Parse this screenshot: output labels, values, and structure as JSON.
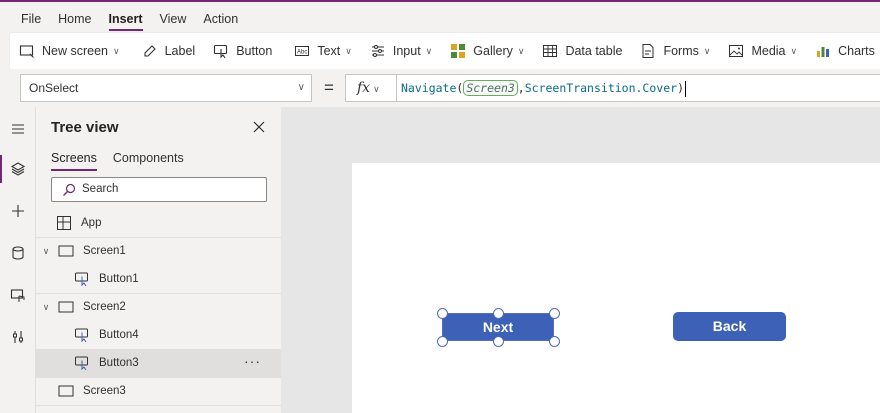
{
  "menu": [
    "File",
    "Home",
    "Insert",
    "View",
    "Action"
  ],
  "menu_active": "Insert",
  "ribbon": {
    "new_screen": "New screen",
    "label": "Label",
    "button": "Button",
    "text": "Text",
    "input": "Input",
    "gallery": "Gallery",
    "data_table": "Data table",
    "forms": "Forms",
    "media": "Media",
    "charts": "Charts"
  },
  "formula_bar": {
    "property": "OnSelect",
    "equals": "=",
    "fx": "fx",
    "formula": {
      "fn": "Navigate",
      "open": "(",
      "arg1": "Screen3",
      "comma": ",",
      "arg2": "ScreenTransition.Cover",
      "close": ")"
    }
  },
  "tree": {
    "title": "Tree view",
    "tabs": [
      "Screens",
      "Components"
    ],
    "search_placeholder": "Search",
    "app": "App",
    "nodes": [
      {
        "label": "Screen1",
        "type": "screen",
        "expanded": true
      },
      {
        "label": "Button1",
        "type": "button"
      },
      {
        "label": "Screen2",
        "type": "screen",
        "expanded": true
      },
      {
        "label": "Button4",
        "type": "button"
      },
      {
        "label": "Button3",
        "type": "button",
        "selected": true
      },
      {
        "label": "Screen3",
        "type": "screen"
      }
    ],
    "more": "···"
  },
  "canvas": {
    "next_button": "Next",
    "back_button": "Back"
  },
  "colors": {
    "accent": "#742774",
    "app_button": "#3c61b7",
    "selection": "#5c6bc0"
  }
}
